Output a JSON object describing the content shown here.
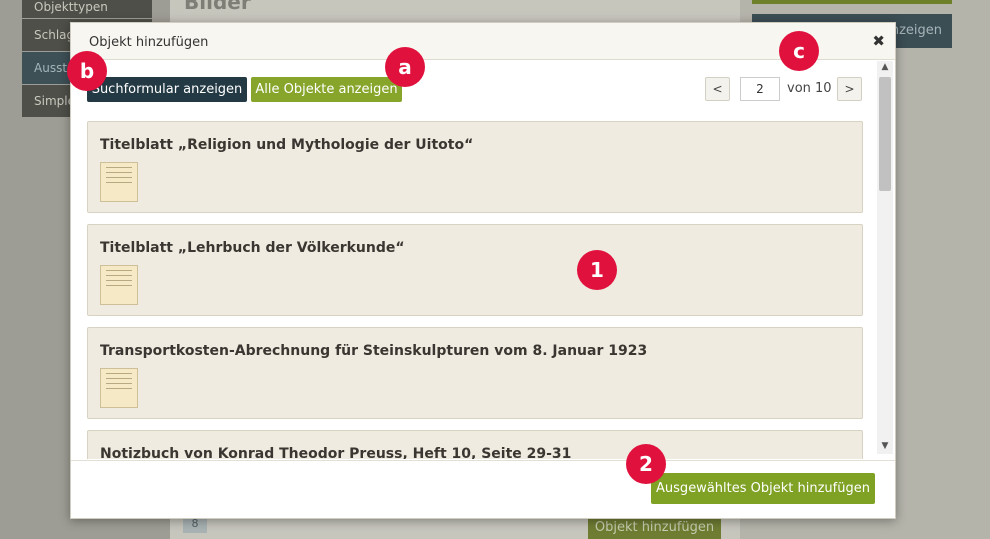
{
  "background": {
    "sidebar_items": [
      "Objekttypen",
      "Schlagworte",
      "Ausstellungen",
      "Simple"
    ],
    "main_title": "Bilder",
    "right_button_label": "anzeigen",
    "item_number": "8",
    "add_object_label": "Objekt hinzufügen"
  },
  "modal": {
    "title": "Objekt hinzufügen",
    "close_glyph": "✖",
    "search_button": "Suchformular anzeigen",
    "all_objects_button": "Alle Objekte anzeigen",
    "pager": {
      "prev": "<",
      "current_page": "2",
      "of_text": "von 10",
      "next": ">"
    },
    "items": [
      {
        "title": "Titelblatt „Religion und Mythologie der Uitoto“"
      },
      {
        "title": "Titelblatt „Lehrbuch der Völkerkunde“"
      },
      {
        "title": "Transportkosten-Abrechnung für Steinskulpturen vom 8. Januar 1923"
      },
      {
        "title": "Notizbuch von Konrad Theodor Preuss, Heft 10, Seite 29-31"
      }
    ],
    "footer_button": "Ausgewähltes Objekt hinzufügen"
  },
  "markers": {
    "a": "a",
    "b": "b",
    "c": "c",
    "one": "1",
    "two": "2"
  },
  "colors": {
    "marker": "#e0113d",
    "primary_dark": "#233a45",
    "primary_green": "#87a52a",
    "card_bg": "#efebe0"
  }
}
